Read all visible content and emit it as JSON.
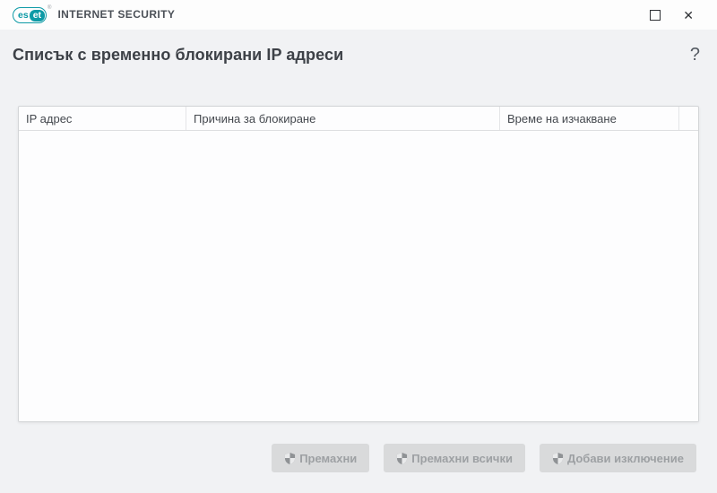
{
  "brand": {
    "logo_es": "es",
    "logo_et": "et",
    "product": "INTERNET SECURITY"
  },
  "icons": {
    "close": "✕",
    "help": "?",
    "trademark": "®",
    "maximize": "square-outline",
    "button_shield": "uac-shield"
  },
  "page": {
    "title": "Списък с временно блокирани IP адреси"
  },
  "table": {
    "columns": [
      "IP адрес",
      "Причина за блокиране",
      "Време на изчакване"
    ],
    "rows": []
  },
  "footer": {
    "buttons": [
      {
        "label": "Премахни",
        "enabled": false
      },
      {
        "label": "Премахни всички",
        "enabled": false
      },
      {
        "label": "Добави изключение",
        "enabled": false
      }
    ]
  },
  "colors": {
    "accent_teal": "#0d9aa6",
    "titlebar_bg": "#fdfdfd",
    "content_bg": "#f1f2f4",
    "panel_bg": "#fdfdfe",
    "panel_border": "#d3d5d7",
    "disabled_button_bg": "#d9dadb",
    "disabled_button_text": "#9da0a3",
    "title_text": "#3d4147"
  }
}
